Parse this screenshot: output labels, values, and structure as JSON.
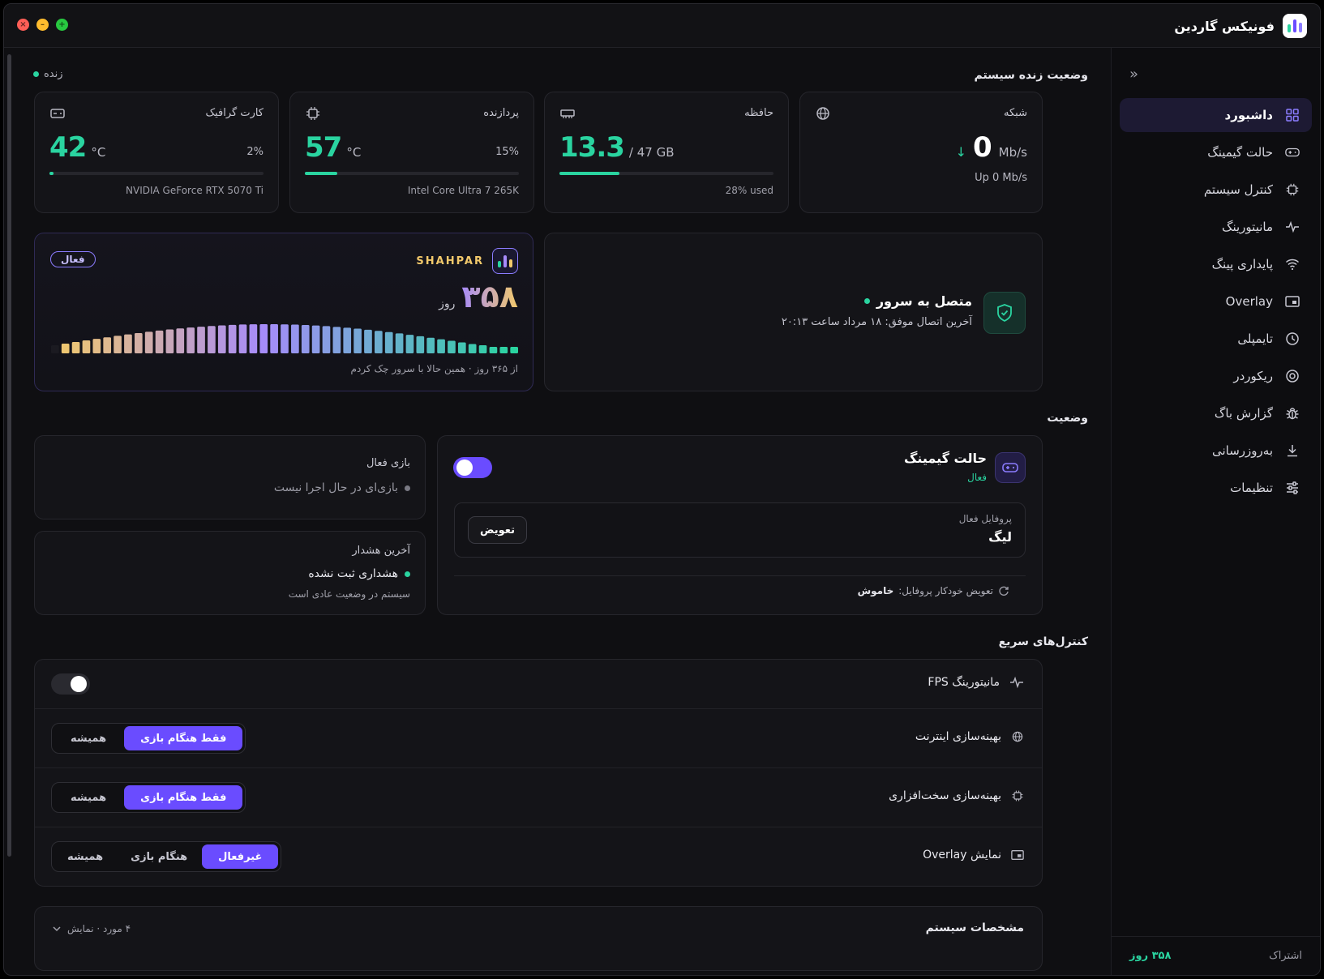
{
  "window": {
    "title": "فونیکس گاردین",
    "controls": [
      "close",
      "minimize",
      "maximize"
    ]
  },
  "sidebar": {
    "items": [
      {
        "label": "داشبورد",
        "icon": "grid-icon",
        "active": true
      },
      {
        "label": "حالت گیمینگ",
        "icon": "gamepad-icon",
        "active": false
      },
      {
        "label": "کنترل سیستم",
        "icon": "cpu-icon",
        "active": false
      },
      {
        "label": "مانیتورینگ",
        "icon": "pulse-icon",
        "active": false
      },
      {
        "label": "پایداری پینگ",
        "icon": "wifi-icon",
        "active": false
      },
      {
        "label": "Overlay",
        "icon": "overlay-icon",
        "active": false
      },
      {
        "label": "تایمپلی",
        "icon": "clock-icon",
        "active": false
      },
      {
        "label": "ریکوردر",
        "icon": "record-icon",
        "active": false
      },
      {
        "label": "گزارش باگ",
        "icon": "bug-icon",
        "active": false
      },
      {
        "label": "به‌روزرسانی",
        "icon": "download-icon",
        "active": false
      },
      {
        "label": "تنظیمات",
        "icon": "sliders-icon",
        "active": false
      }
    ],
    "subscription_label": "اشتراک",
    "subscription_value": "۳۵۸ روز"
  },
  "live_status": {
    "section_title": "وضعیت زنده سیستم",
    "live_label": "زنده",
    "network": {
      "title": "شبکه",
      "arrow": "↓",
      "value": "0",
      "unit": "Mb/s",
      "up": "Up 0 Mb/s"
    },
    "memory": {
      "title": "حافظه",
      "value": "13.3",
      "unit": "/ 47 GB",
      "progress": 0.28,
      "sub": "28% used"
    },
    "cpu": {
      "title": "پردازنده",
      "value": "57",
      "unit": "°C",
      "percent": "15%",
      "progress": 0.15,
      "sub": "Intel Core Ultra 7 265K"
    },
    "gpu": {
      "title": "کارت گرافیک",
      "value": "42",
      "unit": "°C",
      "percent": "2%",
      "progress": 0.02,
      "sub": "NVIDIA GeForce RTX 5070 Ti"
    }
  },
  "server": {
    "title": "متصل به سرور",
    "last": "آخرین اتصال موفق: ۱۸ مرداد ساعت ۲۰:۱۳"
  },
  "shahpar": {
    "badge": "فعال",
    "brand": "SHAHPAR",
    "days": "۳۵۸",
    "days_unit": "روز",
    "remaining": 358,
    "total": 365,
    "caption": "از ۳۶۵ روز · همین حالا با سرور چک کردم"
  },
  "status": {
    "section_title": "وضعیت",
    "gaming": {
      "title": "حالت گیمینگ",
      "state": "فعال",
      "enabled": true,
      "profile_label": "پروفایل فعال",
      "profile_name": "لیگ",
      "switch_label": "تعویض",
      "auto_label": "تعویض خودکار پروفایل:",
      "auto_value": "خاموش"
    },
    "active_game": {
      "title": "بازی فعال",
      "value": "بازی‌ای در حال اجرا نیست"
    },
    "last_warning": {
      "title": "آخرین هشدار",
      "value": "هشداری ثبت نشده",
      "sub": "سیستم در وضعیت عادی است"
    }
  },
  "quick_controls": {
    "section_title": "کنترل‌های سریع",
    "fps": {
      "label": "مانیتورینگ FPS",
      "enabled": false
    },
    "internet": {
      "label": "بهینه‌سازی اینترنت",
      "options": [
        "همیشه",
        "فقط هنگام بازی"
      ],
      "selected": "فقط هنگام بازی"
    },
    "hardware": {
      "label": "بهینه‌سازی سخت‌افزاری",
      "options": [
        "همیشه",
        "فقط هنگام بازی"
      ],
      "selected": "فقط هنگام بازی"
    },
    "overlay": {
      "label": "نمایش Overlay",
      "options": [
        "همیشه",
        "هنگام بازی",
        "غیرفعال"
      ],
      "selected": "غیرفعال"
    }
  },
  "specs": {
    "title": "مشخصات سیستم",
    "meta": "۴ مورد · نمایش"
  },
  "colors": {
    "accent": "#6a4cff",
    "success": "#2ad4a0",
    "gold": "#f2c96b"
  }
}
